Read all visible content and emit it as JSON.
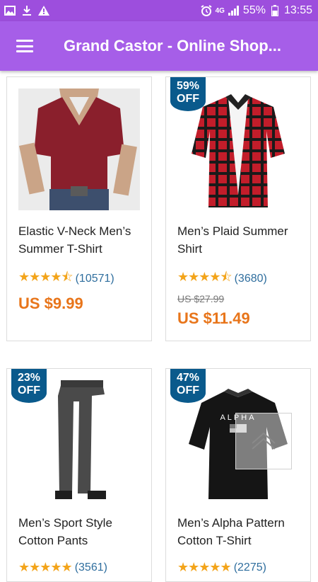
{
  "status_bar": {
    "left_icons": [
      "image-icon",
      "download-icon",
      "warning-icon"
    ],
    "network": "4G",
    "battery": "55%",
    "time": "13:55"
  },
  "app_bar": {
    "title": "Grand Castor - Online Shop..."
  },
  "products": [
    {
      "title": "Elastic V-Neck Men’s Summer T-Shirt",
      "rating_stars": 4.5,
      "review_count": "(10571)",
      "price": "US $9.99",
      "old_price": "",
      "discount": ""
    },
    {
      "title": "Men’s Plaid Summer Shirt",
      "rating_stars": 4.5,
      "review_count": "(3680)",
      "price": "US $11.49",
      "old_price": "US $27.99",
      "discount": {
        "pct": "59%",
        "label": "OFF"
      }
    },
    {
      "title": "Men’s Sport Style Cotton Pants",
      "rating_stars": 5,
      "review_count": "(3561)",
      "discount": {
        "pct": "23%",
        "label": "OFF"
      }
    },
    {
      "title": "Men’s Alpha Pattern Cotton T-Shirt",
      "rating_stars": 5,
      "review_count": "(2275)",
      "discount": {
        "pct": "47%",
        "label": "OFF"
      },
      "image_text": "ALPHA"
    }
  ],
  "colors": {
    "status_bar": "#9d4edd",
    "app_bar": "#a65ee8",
    "price": "#e8751a",
    "badge": "#0a5a8c",
    "stars": "#f3a41a",
    "review_count": "#2f6e9e"
  }
}
